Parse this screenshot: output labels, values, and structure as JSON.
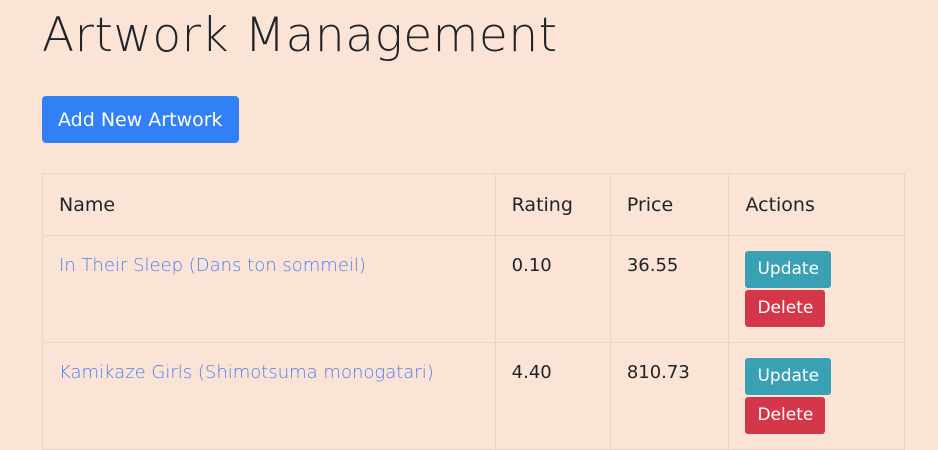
{
  "page": {
    "title": "Artwork Management",
    "add_button_label": "Add New Artwork"
  },
  "table": {
    "headers": [
      "Name",
      "Rating",
      "Price",
      "Actions"
    ],
    "rows": [
      {
        "name": "In Their Sleep (Dans ton sommeil)",
        "rating": "0.10",
        "price": "36.55",
        "update_label": "Update",
        "delete_label": "Delete"
      },
      {
        "name": "Kamikaze Girls (Shimotsuma monogatari)",
        "rating": "4.40",
        "price": "810.73",
        "update_label": "Update",
        "delete_label": "Delete"
      }
    ]
  },
  "colors": {
    "background": "#fbe3d6",
    "primary": "#3280f6",
    "info": "#3aa0b4",
    "danger": "#d5374a",
    "link": "#4d7ff0"
  }
}
